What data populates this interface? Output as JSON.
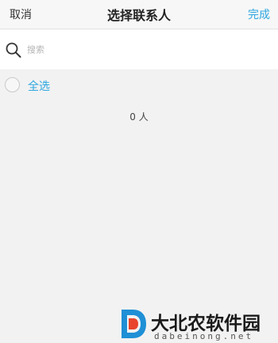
{
  "header": {
    "cancel_label": "取消",
    "title": "选择联系人",
    "done_label": "完成"
  },
  "search": {
    "placeholder": "搜索",
    "value": "",
    "icon": "search-icon"
  },
  "select_all": {
    "label": "全选",
    "checked": false
  },
  "selection_count": "0 人",
  "watermark": {
    "brand": "大北农软件园",
    "domain": "dabeinong.net"
  },
  "colors": {
    "accent": "#2ea7e0",
    "background": "#f2f2f2",
    "header_background": "#f7f7f7",
    "logo_red": "#e8452c",
    "logo_blue": "#1f8fd6"
  }
}
